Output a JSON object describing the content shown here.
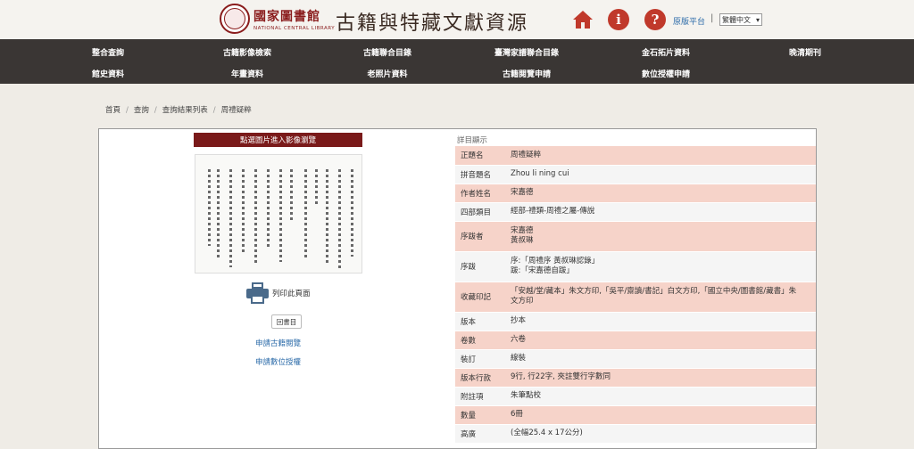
{
  "header": {
    "logo_cn": "國家圖書館",
    "logo_en": "NATIONAL CENTRAL LIBRARY",
    "site_title": "古籍與特藏文獻資源",
    "home_icon": "home-icon",
    "info_icon": "info-icon",
    "help_icon": "help-icon",
    "orig_platform": "原版平台",
    "separator": "|",
    "language": "繁體中文"
  },
  "nav": {
    "row1": [
      "整合查詢",
      "古籍影像檢索",
      "古籍聯合目錄",
      "臺灣家譜聯合目錄",
      "金石拓片資料",
      "晚清期刊"
    ],
    "row2": [
      "館史資料",
      "年畫資料",
      "老照片資料",
      "古籍閱覽申請",
      "數位授權申請"
    ]
  },
  "breadcrumb": [
    "首頁",
    "查詢",
    "查詢結果列表",
    "周禮疑粹"
  ],
  "left": {
    "view_button": "點選圖片進入影像瀏覽",
    "print_label": "列印此頁面",
    "back_button": "回書目",
    "link_reading": "申請古籍閱覽",
    "link_digital": "申請數位授權"
  },
  "details": {
    "heading": "詳目顯示",
    "rows": [
      {
        "label": "正題名",
        "value": [
          "周禮疑粹"
        ]
      },
      {
        "label": "拼音題名",
        "value": [
          "Zhou li ning cui"
        ]
      },
      {
        "label": "作者姓名",
        "value": [
          "宋嘉德"
        ]
      },
      {
        "label": "四部類目",
        "value": [
          "經部-禮類-周禮之屬-傳說"
        ]
      },
      {
        "label": "序跋者",
        "value": [
          "宋嘉德",
          "黃叔琳"
        ]
      },
      {
        "label": "序跋",
        "value": [
          "序:「周禮序 黃叔琳認錄」",
          "跋:「宋嘉德自跋」"
        ]
      },
      {
        "label": "收藏印記",
        "value": [
          "「安越/堂/藏本」朱文方印,「吳平/齋讀/書記」白文方印,「國立中央/圖書館/藏書」朱",
          "文方印"
        ]
      },
      {
        "label": "版本",
        "value": [
          "抄本"
        ]
      },
      {
        "label": "卷數",
        "value": [
          "六卷"
        ]
      },
      {
        "label": "裝訂",
        "value": [
          "線裝"
        ]
      },
      {
        "label": "版本行款",
        "value": [
          "9行, 行22字, 夾註雙行字數同"
        ]
      },
      {
        "label": "附註項",
        "value": [
          "朱筆點校"
        ]
      },
      {
        "label": "數量",
        "value": [
          "6冊"
        ]
      },
      {
        "label": "高廣",
        "value": [
          "(全幅25.4 x 17公分)"
        ]
      }
    ]
  },
  "colors": {
    "nav_bg": "#3a3634",
    "accent_red": "#7a1a1a",
    "icon_red": "#c0392b",
    "row_pink": "#f6d3c9",
    "link_blue": "#2a6aa8"
  }
}
